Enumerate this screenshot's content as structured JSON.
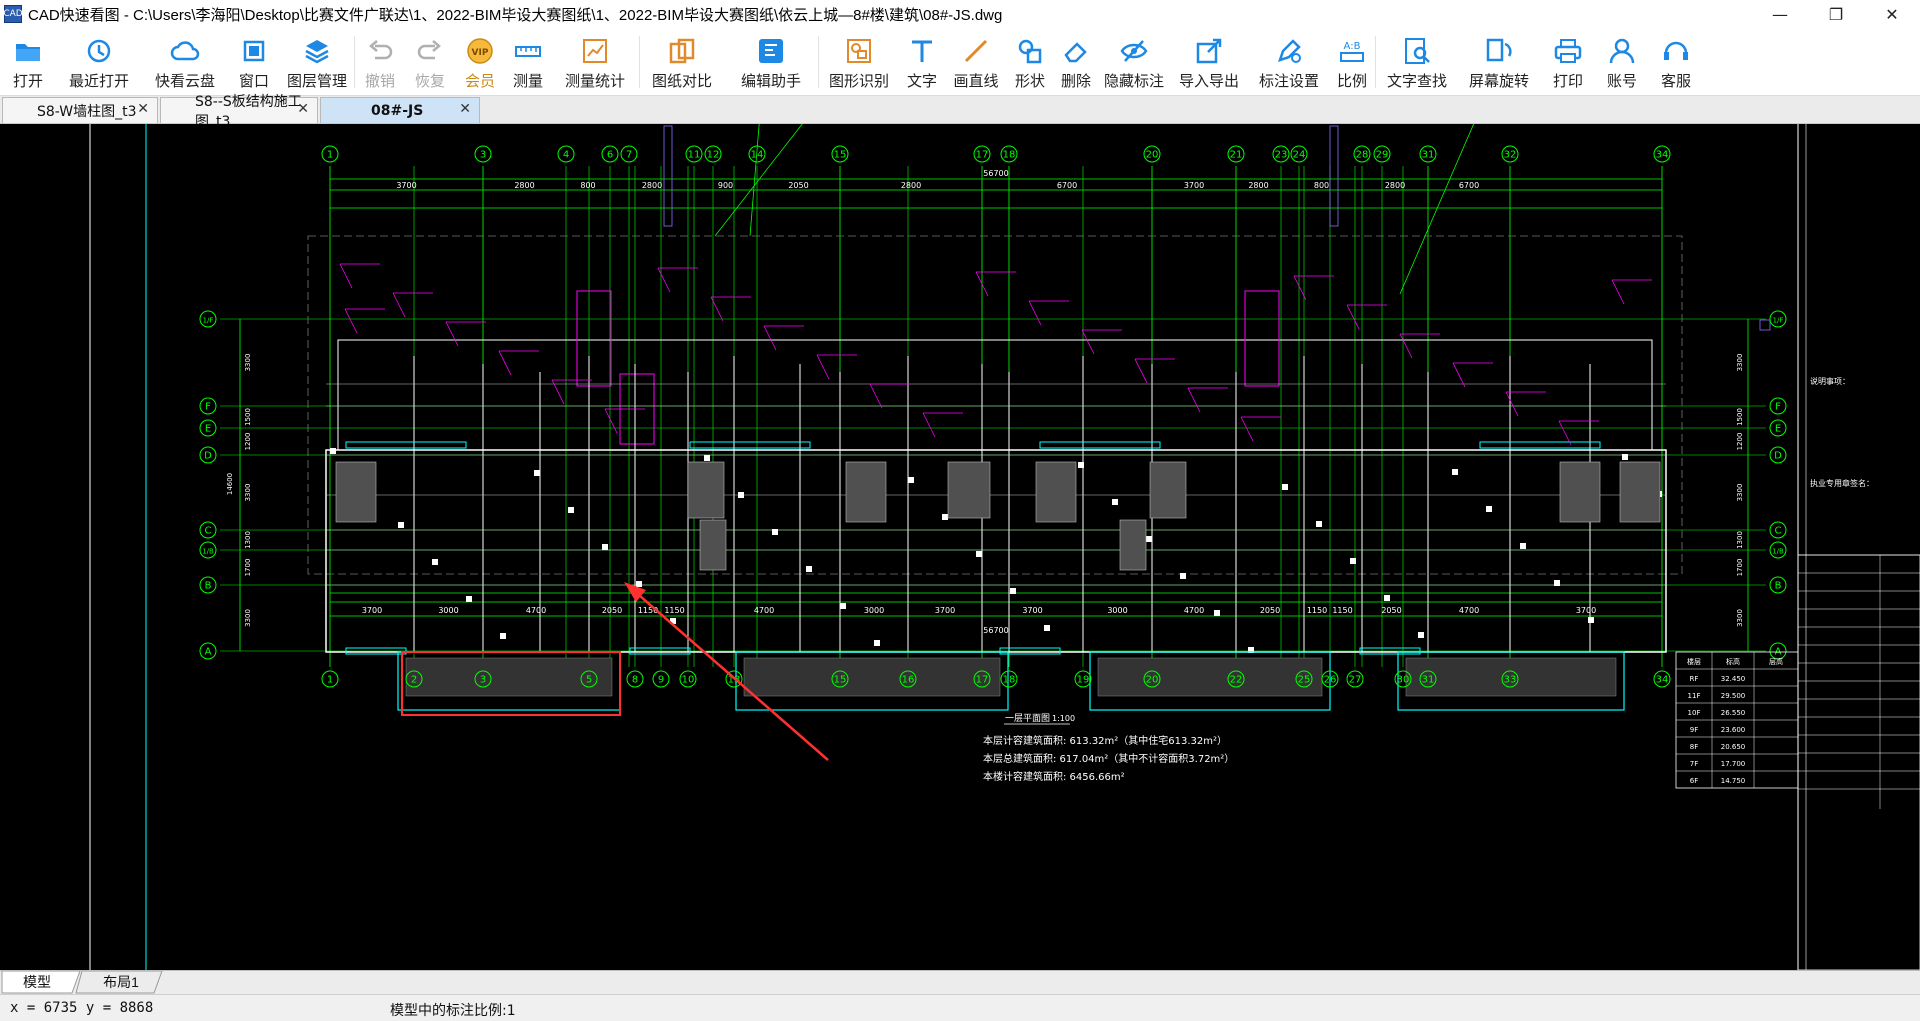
{
  "window": {
    "app_icon_text": "CAD",
    "title": "CAD快速看图 - C:\\Users\\李海阳\\Desktop\\比赛文件广联达\\1、2022-BIM毕设大赛图纸\\1、2022-BIM毕设大赛图纸\\依云上城—8#楼\\建筑\\08#-JS.dwg",
    "minimize": "—",
    "restore": "❐",
    "close": "✕"
  },
  "toolbar": {
    "open": "打开",
    "recent": "最近打开",
    "cloud": "快看云盘",
    "window": "窗口",
    "layers": "图层管理",
    "undo": "撤销",
    "redo": "恢复",
    "vip": "会员",
    "vip_badge": "VIP",
    "measure": "测量",
    "measure_stats": "测量统计",
    "compare": "图纸对比",
    "edit_helper": "编辑助手",
    "shape_recog": "图形识别",
    "text": "文字",
    "line": "画直线",
    "shape": "形状",
    "delete": "删除",
    "hide_annot": "隐藏标注",
    "import_export": "导入导出",
    "annot_settings": "标注设置",
    "scale": "比例",
    "scale_icon": "A:B",
    "text_search": "文字查找",
    "screen_rotate": "屏幕旋转",
    "print": "打印",
    "account": "账号",
    "service": "客服"
  },
  "tabs": [
    {
      "label": "S8-W墙柱图_t3",
      "close": "✕"
    },
    {
      "label": "S8--S板结构施工图_t3",
      "close": "✕"
    },
    {
      "label": "08#-JS",
      "close": "✕"
    }
  ],
  "drawing": {
    "grid_top": [
      "1",
      "3",
      "4",
      "6",
      "7",
      "11",
      "12",
      "14",
      "15",
      "17",
      "18",
      "20",
      "21",
      "23",
      "24",
      "28",
      "29",
      "31",
      "32",
      "34"
    ],
    "grid_bottom": [
      "1",
      "2",
      "3",
      "5",
      "8",
      "9",
      "10",
      "13",
      "15",
      "16",
      "17",
      "18",
      "19",
      "20",
      "22",
      "25",
      "26",
      "27",
      "30",
      "31",
      "33",
      "34"
    ],
    "grid_left": [
      "1/F",
      "F",
      "E",
      "D",
      "C",
      "1/B",
      "B",
      "A"
    ],
    "dims_top": [
      "3700",
      "2800",
      "800",
      "2800",
      "900",
      "2050",
      "2800",
      "6700",
      "3700",
      "2800",
      "800",
      "2800",
      "6700"
    ],
    "overall_dim": "56700",
    "dims_bottom": [
      "3700",
      "3000",
      "4700",
      "2050",
      "1150",
      "1150",
      "4700",
      "3000",
      "3700",
      "3700",
      "3000",
      "4700",
      "2050",
      "1150",
      "1150",
      "2050",
      "4700",
      "3700"
    ],
    "dims_left": [
      "3300",
      "1500",
      "1200",
      "3300",
      "1300",
      "1700",
      "3300"
    ],
    "total_height": "14600",
    "plan_title": "一层平面图",
    "plan_scale": "1:100",
    "notes": [
      "本层计容建筑面积: 613.32m²（其中住宅613.32m²）",
      "本层总建筑面积: 617.04m²（其中不计容面积3.72m²）",
      "本楼计容建筑面积: 6456.66m²"
    ],
    "right_notes": [
      "说明事项：",
      "执业专用章签名："
    ],
    "level_table_headers": [
      "楼层",
      "标高",
      "层高"
    ],
    "level_table_rows": [
      [
        "RF",
        "32.450",
        ""
      ],
      [
        "11F",
        "29.500",
        ""
      ],
      [
        "10F",
        "26.550",
        ""
      ],
      [
        "9F",
        "23.600",
        ""
      ],
      [
        "8F",
        "20.650",
        ""
      ],
      [
        "7F",
        "17.700",
        ""
      ],
      [
        "6F",
        "14.750",
        ""
      ]
    ]
  },
  "layout_tabs": [
    "模型",
    "布局1"
  ],
  "status": {
    "coords": "x = 6735  y = 8868",
    "scale": "模型中的标注比例:1"
  },
  "colors": {
    "canvas_bg": "#000000",
    "grid_line": "#00ff00",
    "wall": "#ffffff",
    "axis_text": "#00ff00",
    "magenta": "#ff00ff",
    "cyan": "#00ffff",
    "red_box": "#ff3030",
    "accent_blue": "#1e88e5"
  }
}
